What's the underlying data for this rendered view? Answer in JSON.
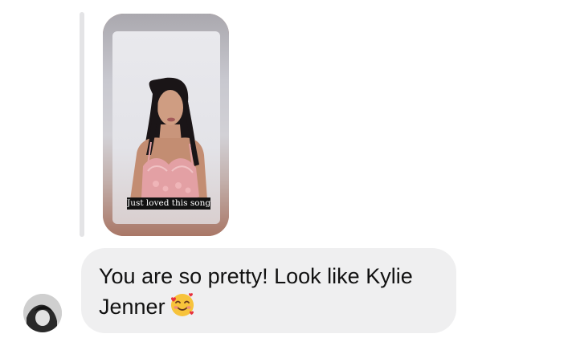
{
  "story_reply": {
    "caption": "Just loved this song"
  },
  "message": {
    "text": "You are so pretty! Look like Kylie Jenner",
    "emoji": "smiling-face-with-hearts-icon"
  },
  "colors": {
    "bubble_bg": "#efeff0",
    "reply_bar": "#e4e4e6",
    "text": "#111111"
  }
}
